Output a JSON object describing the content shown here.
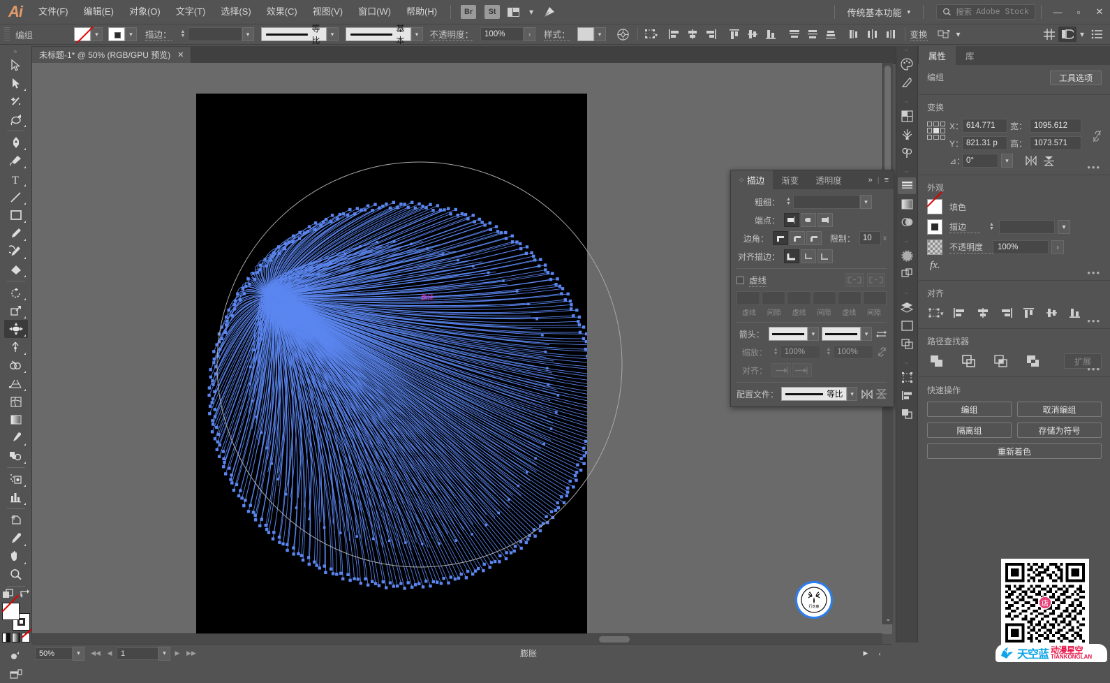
{
  "app": {
    "logo": "Ai",
    "menus": [
      "文件(F)",
      "编辑(E)",
      "对象(O)",
      "文字(T)",
      "选择(S)",
      "效果(C)",
      "视图(V)",
      "窗口(W)",
      "帮助(H)"
    ],
    "bridge_chip": "Br",
    "stock_chip": "St",
    "workspace": "传统基本功能",
    "stock_search_label": "搜索",
    "stock_search_brand": "Adobe Stock",
    "window_minimize": "—",
    "window_maximize": "▫",
    "window_close": "✕"
  },
  "controlbar": {
    "selection_label": "编组",
    "fill_label": "",
    "stroke_label": "描边：",
    "stroke_weight_value": "",
    "variable_width_profile": "等比",
    "brush_definition": "基本",
    "opacity_label": "不透明度：",
    "opacity_value": "100%",
    "style_label": "样式：",
    "transform_label": "变换"
  },
  "document": {
    "tab_title": "未标题-1* @ 50% (RGB/GPU 预览)",
    "tab_close": "✕"
  },
  "canvas": {
    "path_label": "路径",
    "artwork_stroke_color": "#5b86f0",
    "artboard_background": "#000000"
  },
  "statusbar": {
    "zoom": "50%",
    "page": "1",
    "tool_status": "膨胀",
    "first_page": "◀◀",
    "prev_page": "◀",
    "next_page": "▶",
    "last_page": "▶▶"
  },
  "stroke_panel": {
    "tabs": [
      {
        "label": "描边",
        "active": true
      },
      {
        "label": "渐变",
        "active": false
      },
      {
        "label": "透明度",
        "active": false
      }
    ],
    "overflow": "»",
    "menu": "≡",
    "weight_label": "粗细：",
    "weight_value": "",
    "cap_label": "端点：",
    "corner_label": "边角：",
    "limit_label": "限制：",
    "limit_value": "10",
    "limit_unit": "x",
    "align_label": "对齐描边：",
    "dashed_label": "虚线",
    "dash_fields": [
      "虚线",
      "间隙",
      "虚线",
      "间隙",
      "虚线",
      "间隙"
    ],
    "arrowhead_label": "箭头：",
    "scale_label": "缩放：",
    "scale_start": "100%",
    "scale_end": "100%",
    "arrow_align_label": "对齐：",
    "profile_label": "配置文件：",
    "profile_value": "等比"
  },
  "properties": {
    "tabs": [
      {
        "label": "属性",
        "active": true
      },
      {
        "label": "库",
        "active": false
      }
    ],
    "selection": {
      "title": "编组",
      "tool_options_button": "工具选项"
    },
    "transform": {
      "title": "变换",
      "x_label": "X：",
      "x_value": "614.771",
      "y_label": "Y：",
      "y_value": "821.31 p",
      "w_label": "宽：",
      "w_value": "1095.612",
      "h_label": "高：",
      "h_value": "1073.571",
      "angle_label": "⊿：",
      "angle_value": "0°"
    },
    "appearance": {
      "title": "外观",
      "fill_label": "填色",
      "stroke_label": "描边",
      "stroke_weight_value": "",
      "opacity_label": "不透明度",
      "opacity_value": "100%",
      "fx_label": "fx."
    },
    "align": {
      "title": "对齐"
    },
    "pathfinder": {
      "title": "路径查找器",
      "expand_button": "扩展"
    },
    "quick_actions": {
      "title": "快速操作",
      "buttons": [
        "编组",
        "取消编组",
        "隔离组",
        "存储为符号",
        "重新着色"
      ]
    }
  },
  "watermark": {
    "logo_text": "行走鹿",
    "brand_cn": "天空蓝",
    "brand_red": "动漫星空",
    "brand_en": "TIANKONGLAN"
  }
}
